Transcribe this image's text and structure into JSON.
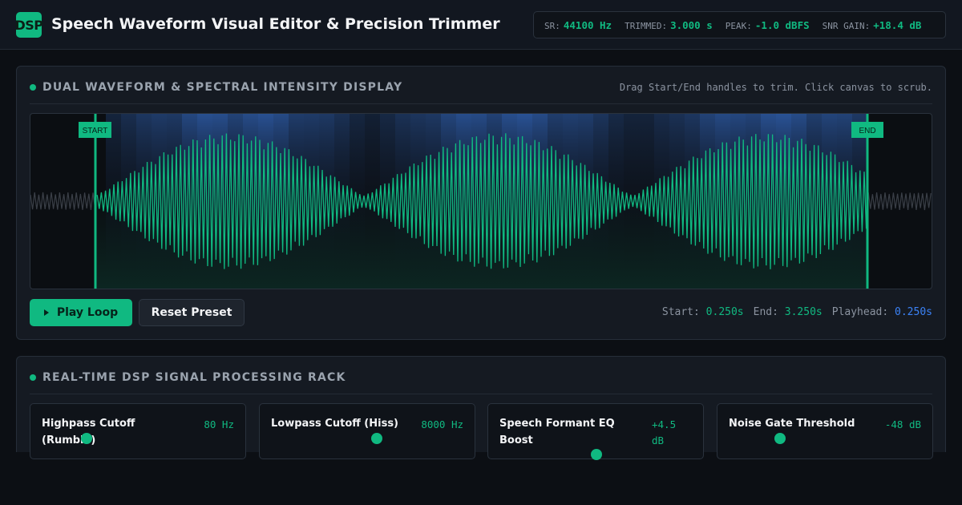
{
  "header": {
    "logo_text": "DSP",
    "title": "Speech Waveform Visual Editor & Precision Trimmer",
    "stats": [
      {
        "label": "SR:",
        "value": "44100 Hz"
      },
      {
        "label": "TRIMMED:",
        "value": "3.000 s"
      },
      {
        "label": "PEAK:",
        "value": "-1.0 dBFS"
      },
      {
        "label": "SNR GAIN:",
        "value": "+18.4 dB"
      }
    ]
  },
  "waveform_panel": {
    "title": "DUAL WAVEFORM & SPECTRAL INTENSITY DISPLAY",
    "hint": "Drag Start/End handles to trim. Click canvas to scrub.",
    "start_handle_label": "START",
    "end_handle_label": "END",
    "play_button": "Play Loop",
    "reset_button": "Reset Preset",
    "readout": {
      "start_label": "Start:",
      "start_value": "0.250s",
      "end_label": "End:",
      "end_value": "3.250s",
      "playhead_label": "Playhead:",
      "playhead_value": "0.250s"
    },
    "trim": {
      "start_s": 0.25,
      "end_s": 3.25,
      "total_s": 3.5
    }
  },
  "dsp_panel": {
    "title": "REAL-TIME DSP SIGNAL PROCESSING RACK",
    "controls": [
      {
        "label": "Highpass Cutoff (Rumble)",
        "value": "80 Hz",
        "level": 0.18
      },
      {
        "label": "Lowpass Cutoff (Hiss)",
        "value": "8000 Hz",
        "level": 0.55
      },
      {
        "label": "Speech Formant EQ Boost",
        "value": "+4.5 dB",
        "level": 0.5
      },
      {
        "label": "Noise Gate Threshold",
        "value": "-48 dB",
        "level": 0.22
      }
    ]
  },
  "colors": {
    "accent": "#10b981",
    "playhead": "#3b82f6",
    "spectral": "#2f5fae",
    "outside_wave": "#3a3f47"
  }
}
